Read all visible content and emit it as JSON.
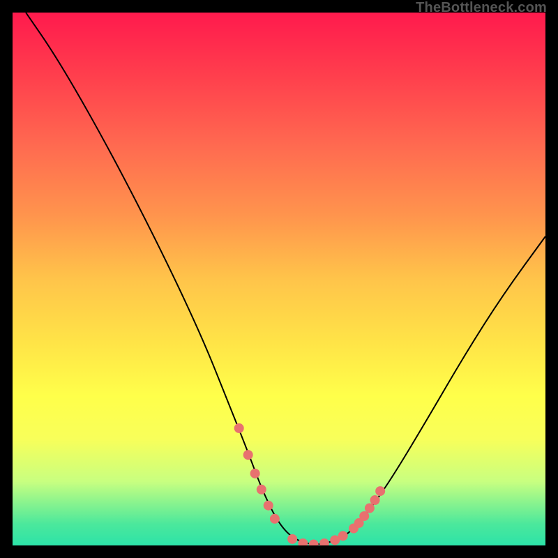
{
  "watermark": "TheBottleneck.com",
  "chart_data": {
    "type": "line",
    "title": "",
    "xlabel": "",
    "ylabel": "",
    "xlim": [
      0,
      100
    ],
    "ylim": [
      0,
      100
    ],
    "curve": [
      {
        "x": 2.5,
        "y": 100
      },
      {
        "x": 8,
        "y": 92
      },
      {
        "x": 15,
        "y": 80
      },
      {
        "x": 22.5,
        "y": 66
      },
      {
        "x": 30,
        "y": 51
      },
      {
        "x": 36,
        "y": 38
      },
      {
        "x": 40,
        "y": 28
      },
      {
        "x": 44,
        "y": 18
      },
      {
        "x": 47,
        "y": 10
      },
      {
        "x": 50,
        "y": 4
      },
      {
        "x": 53,
        "y": 1
      },
      {
        "x": 57,
        "y": 0
      },
      {
        "x": 61,
        "y": 1
      },
      {
        "x": 64,
        "y": 3
      },
      {
        "x": 68,
        "y": 8
      },
      {
        "x": 72,
        "y": 14
      },
      {
        "x": 78,
        "y": 24
      },
      {
        "x": 85,
        "y": 36
      },
      {
        "x": 92,
        "y": 47
      },
      {
        "x": 100,
        "y": 58
      }
    ],
    "highlight_points": [
      {
        "x": 42.5,
        "y": 22
      },
      {
        "x": 44.2,
        "y": 17
      },
      {
        "x": 45.5,
        "y": 13.5
      },
      {
        "x": 46.7,
        "y": 10.5
      },
      {
        "x": 48.0,
        "y": 7.5
      },
      {
        "x": 49.2,
        "y": 5.0
      },
      {
        "x": 52.5,
        "y": 1.2
      },
      {
        "x": 54.5,
        "y": 0.4
      },
      {
        "x": 56.5,
        "y": 0.2
      },
      {
        "x": 58.5,
        "y": 0.4
      },
      {
        "x": 60.5,
        "y": 1.0
      },
      {
        "x": 62.0,
        "y": 1.8
      },
      {
        "x": 64.0,
        "y": 3.2
      },
      {
        "x": 65.0,
        "y": 4.2
      },
      {
        "x": 66.0,
        "y": 5.5
      },
      {
        "x": 67.0,
        "y": 7.0
      },
      {
        "x": 68.0,
        "y": 8.5
      },
      {
        "x": 69.0,
        "y": 10.2
      }
    ],
    "colors": {
      "curve": "#000000",
      "points": "#e8716f",
      "gradient_top": "#ff1a4d",
      "gradient_bottom": "#2de3a8"
    }
  }
}
